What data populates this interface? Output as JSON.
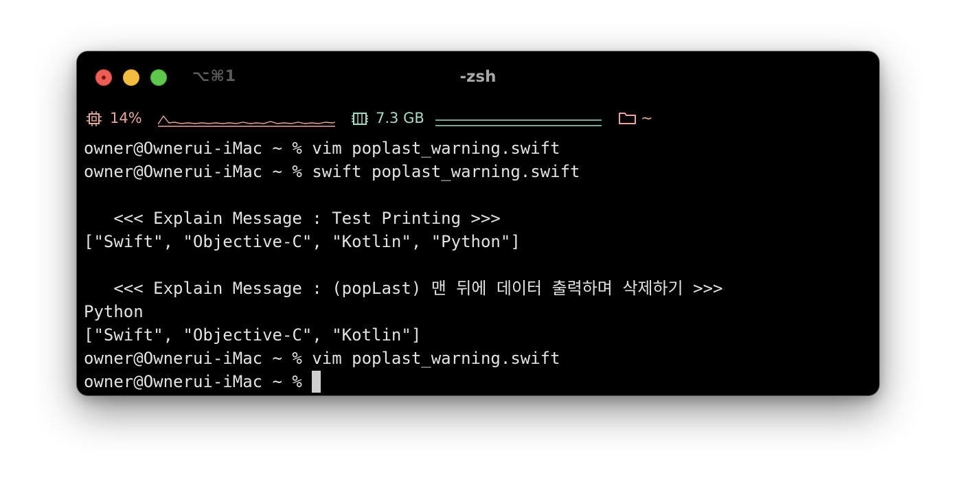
{
  "window": {
    "title": "-zsh",
    "shortcut": "⌥⌘1",
    "controls": [
      "close",
      "minimize",
      "zoom"
    ]
  },
  "statusbar": {
    "cpu_icon": "cpu-chip-icon",
    "cpu_label": "14%",
    "memory_icon": "memory-icon",
    "memory_label": "7.3 GB",
    "folder_icon": "folder-icon",
    "directory_label": "~",
    "colors": {
      "cpu": "#e9a69a",
      "memory": "#a8dcc4"
    }
  },
  "terminal": {
    "lines": [
      "owner@Ownerui-iMac ~ % vim poplast_warning.swift",
      "owner@Ownerui-iMac ~ % swift poplast_warning.swift",
      "",
      "   <<< Explain Message : Test Printing >>>",
      "[\"Swift\", \"Objective-C\", \"Kotlin\", \"Python\"]",
      "",
      "   <<< Explain Message : (popLast) 맨 뒤에 데이터 출력하며 삭제하기 >>>",
      "Python",
      "[\"Swift\", \"Objective-C\", \"Kotlin\"]",
      "owner@Ownerui-iMac ~ % vim poplast_warning.swift",
      "owner@Ownerui-iMac ~ % "
    ]
  }
}
